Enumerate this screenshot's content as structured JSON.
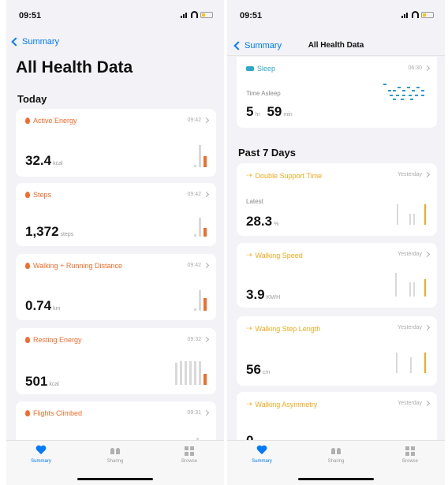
{
  "left": {
    "time": "09:51",
    "back_label": "Summary",
    "title": "All Health Data",
    "section": "Today",
    "cards": [
      {
        "category": "Active Energy",
        "time": "09:42",
        "value": "32.4",
        "unit": "kcal"
      },
      {
        "category": "Steps",
        "time": "09:42",
        "value": "1,372",
        "unit": "steps"
      },
      {
        "category": "Walking + Running Distance",
        "time": "09:42",
        "value": "0.74",
        "unit": "km"
      },
      {
        "category": "Resting Energy",
        "time": "09:32",
        "value": "501",
        "unit": "kcal"
      },
      {
        "category": "Flights Climbed",
        "time": "09:31"
      }
    ]
  },
  "right": {
    "time": "09:51",
    "back_label": "Summary",
    "nav_title": "All Health Data",
    "sleep": {
      "category": "Sleep",
      "time": "06:30",
      "label": "Time Asleep",
      "hours": "5",
      "hours_unit": "hr",
      "minutes": "59",
      "minutes_unit": "min"
    },
    "section": "Past 7 Days",
    "cards": [
      {
        "category": "Double Support Time",
        "time": "Yesterday",
        "label": "Latest",
        "value": "28.3",
        "unit": "%"
      },
      {
        "category": "Walking Speed",
        "time": "Yesterday",
        "value": "3.9",
        "unit": "KM/H"
      },
      {
        "category": "Walking Step Length",
        "time": "Yesterday",
        "value": "56",
        "unit": "cm"
      },
      {
        "category": "Walking Asymmetry",
        "time": "Yesterday",
        "value": "0"
      }
    ]
  },
  "tabs": [
    "Summary",
    "Sharing",
    "Browse"
  ],
  "colors": {
    "accent": "#007aff",
    "activity": "#f46b2a",
    "mobility": "#f2a91e",
    "sleep": "#2ea8c9"
  }
}
